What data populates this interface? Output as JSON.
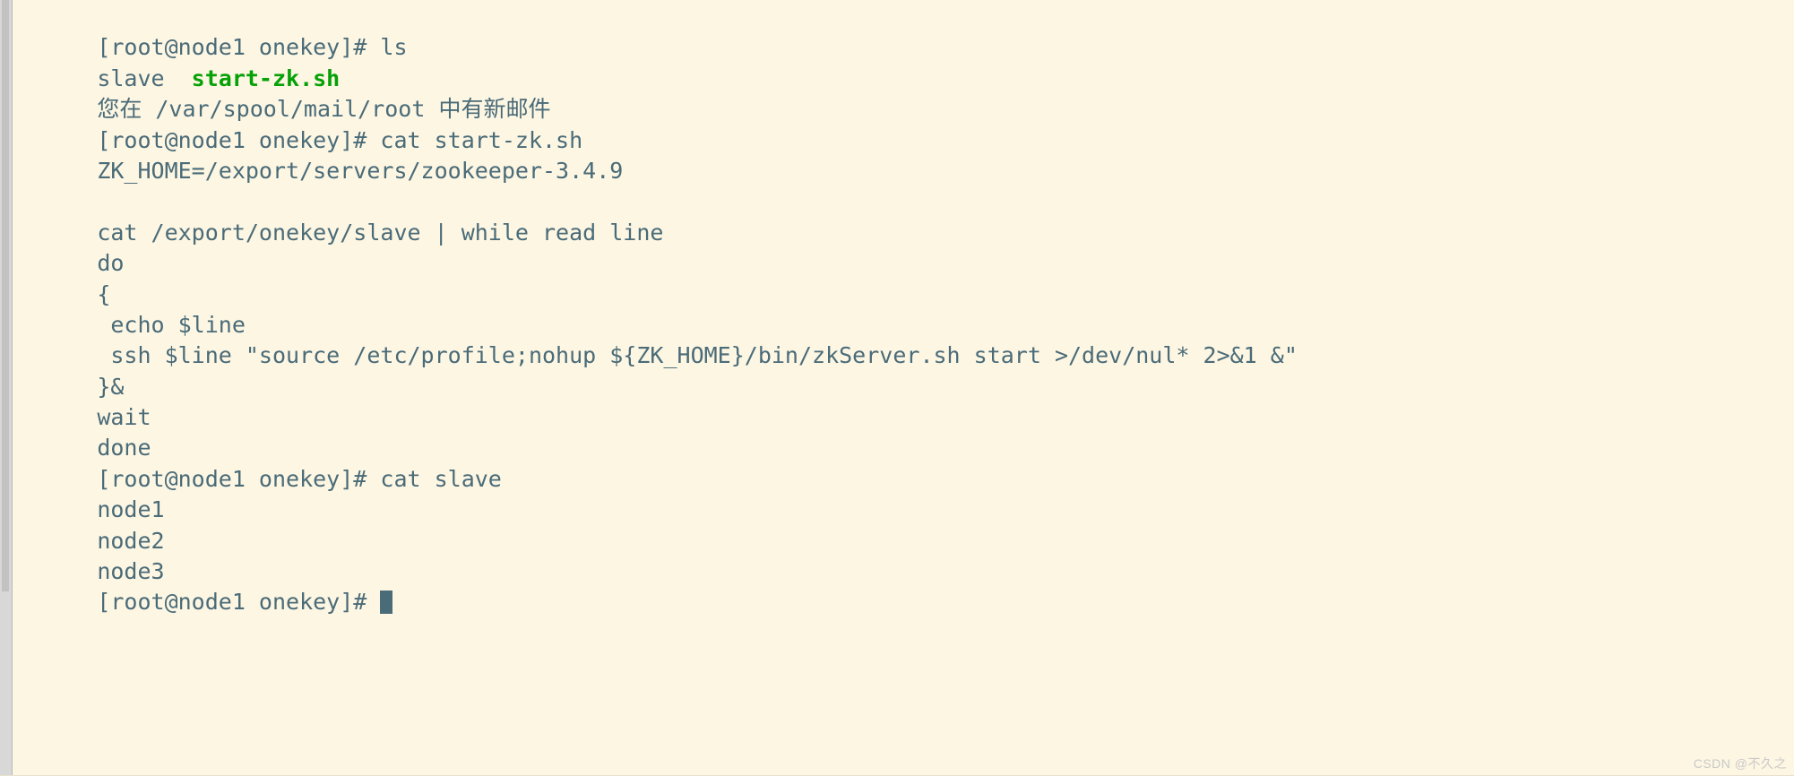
{
  "terminal": {
    "app": "ssh-terminal",
    "colors": {
      "background": "#fdf6e3",
      "foreground": "#4a6b78",
      "executable_green": "#06a106",
      "gutter": "#d8d8d8",
      "watermark": "#c9c9c9"
    },
    "prompt": "[root@node1 onekey]#",
    "cursor": {
      "shape": "block",
      "visible": true
    },
    "lines": [
      {
        "id": "line-01",
        "type": "prompt",
        "text": "[root@node1 onekey]# ls"
      },
      {
        "id": "line-02",
        "type": "output-ls",
        "prefix": "slave  ",
        "green": "start-zk.sh",
        "text": "slave  start-zk.sh"
      },
      {
        "id": "line-03",
        "type": "output",
        "text": "您在 /var/spool/mail/root 中有新邮件"
      },
      {
        "id": "line-04",
        "type": "prompt",
        "text": "[root@node1 onekey]# cat start-zk.sh"
      },
      {
        "id": "line-05",
        "type": "output",
        "text": "ZK_HOME=/export/servers/zookeeper-3.4.9"
      },
      {
        "id": "line-06",
        "type": "blank",
        "text": ""
      },
      {
        "id": "line-07",
        "type": "output",
        "text": "cat /export/onekey/slave | while read line"
      },
      {
        "id": "line-08",
        "type": "output",
        "text": "do"
      },
      {
        "id": "line-09",
        "type": "output",
        "text": "{"
      },
      {
        "id": "line-10",
        "type": "output",
        "text": " echo $line"
      },
      {
        "id": "line-11",
        "type": "output",
        "text": " ssh $line \"source /etc/profile;nohup ${ZK_HOME}/bin/zkServer.sh start >/dev/nul* 2>&1 &\""
      },
      {
        "id": "line-12",
        "type": "output",
        "text": "}&"
      },
      {
        "id": "line-13",
        "type": "output",
        "text": "wait"
      },
      {
        "id": "line-14",
        "type": "output",
        "text": "done"
      },
      {
        "id": "line-15",
        "type": "prompt",
        "text": "[root@node1 onekey]# cat slave"
      },
      {
        "id": "line-16",
        "type": "output",
        "text": "node1"
      },
      {
        "id": "line-17",
        "type": "output",
        "text": "node2"
      },
      {
        "id": "line-18",
        "type": "output",
        "text": "node3"
      },
      {
        "id": "line-19",
        "type": "prompt-cursor",
        "text": "[root@node1 onekey]# "
      }
    ]
  },
  "watermark": {
    "text": "CSDN @不久之"
  }
}
